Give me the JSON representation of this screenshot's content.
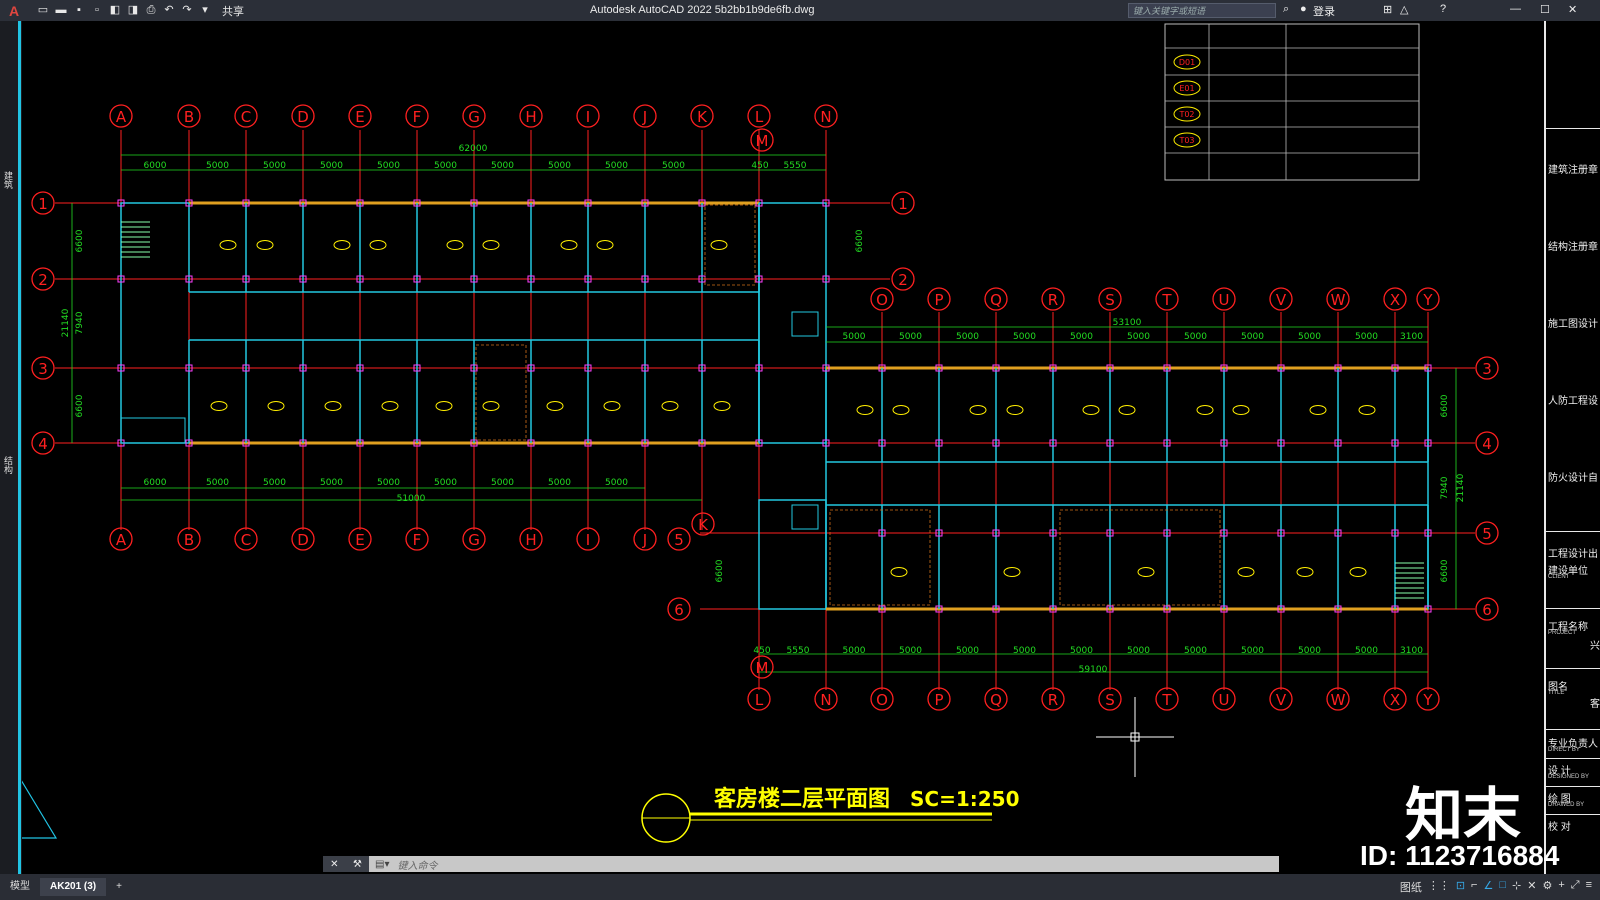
{
  "titlebar": {
    "app_logo": "A",
    "share_label": "共享",
    "window_title": "Autodesk AutoCAD 2022    5b2bb1b9de6fb.dwg",
    "search_placeholder": "键入关键字或短语",
    "login_label": "登录"
  },
  "palette": {
    "items": [
      "建筑",
      "结构"
    ]
  },
  "right_panel": {
    "items": [
      "建筑注册章",
      "结构注册章",
      "施工图设计",
      "人防工程设",
      "防火设计自",
      "工程设计出",
      "建设单位",
      "工程名称",
      "图名",
      "专业负责人",
      "设    计",
      "绘    图",
      "校    对"
    ],
    "small_labels": [
      "CLIENT",
      "PROJECT",
      "TITLE",
      "DIRECT BY",
      "DESIGNED BY",
      "DRAWED BY"
    ],
    "right_chars": [
      "兴",
      "客"
    ]
  },
  "drawing": {
    "title": "客房楼二层平面图",
    "scale": "SC=1:250",
    "legend_codes": [
      "D01",
      "E01",
      "T02",
      "T03"
    ],
    "axes_top_left": [
      "A",
      "B",
      "C",
      "D",
      "E",
      "F",
      "G",
      "H",
      "I",
      "J",
      "K",
      "L",
      "N"
    ],
    "axes_bottom_left": [
      "A",
      "B",
      "C",
      "D",
      "E",
      "F",
      "G",
      "H",
      "I",
      "J"
    ],
    "axes_right_top": [
      "O",
      "P",
      "Q",
      "R",
      "S",
      "T",
      "U",
      "V",
      "W",
      "X",
      "Y"
    ],
    "axes_bottom_right": [
      "L",
      "N",
      "O",
      "P",
      "Q",
      "R",
      "S",
      "T",
      "U",
      "V",
      "W",
      "X",
      "Y"
    ],
    "rows_left": [
      "1",
      "2",
      "3",
      "4"
    ],
    "rows_right": [
      "1",
      "2",
      "3",
      "4",
      "5",
      "6"
    ],
    "dim_total_top": "62000",
    "dim_total_bottom_left": "51000",
    "dim_total_right_top": "53100",
    "dim_total_right_bottom": "59100",
    "dims_top": [
      "6000",
      "5000",
      "5000",
      "5000",
      "5000",
      "5000",
      "5000",
      "5000",
      "5000",
      "5000",
      "450",
      "5550"
    ],
    "dims_bottom_left": [
      "6000",
      "5000",
      "5000",
      "5000",
      "5000",
      "5000",
      "5000",
      "5000",
      "5000"
    ],
    "dims_right_top": [
      "5000",
      "5000",
      "5000",
      "5000",
      "5000",
      "5000",
      "5000",
      "5000",
      "5000",
      "5000",
      "3100"
    ],
    "dims_right_bottom": [
      "450",
      "5550",
      "5000",
      "5000",
      "5000",
      "5000",
      "5000",
      "5000",
      "5000",
      "5000",
      "5000",
      "5000",
      "3100"
    ],
    "vertical_dims_left": [
      "6600",
      "7940",
      "21140",
      "6600"
    ],
    "vertical_dims_right": [
      "6600",
      "7940",
      "21140",
      "6600"
    ],
    "axis_m": "M",
    "axis_k": "K",
    "axis_5": "5"
  },
  "cmd": {
    "prompt": "键入命令"
  },
  "statusbar": {
    "tabs": [
      "模型",
      "AK201 (3)"
    ],
    "add": "+",
    "paper_label": "图纸"
  },
  "watermark": {
    "logo": "知末",
    "id": "ID: 1123716884"
  }
}
